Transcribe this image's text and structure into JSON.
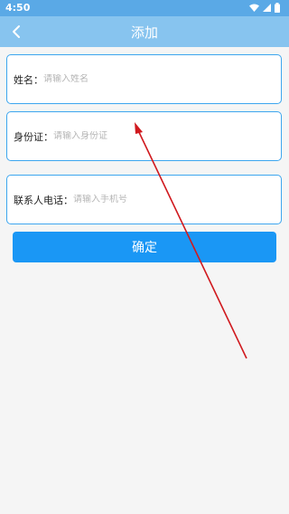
{
  "status_bar": {
    "time": "4:50",
    "icons": [
      "wifi-icon",
      "cell-signal-icon",
      "battery-icon"
    ]
  },
  "app_bar": {
    "title": "添加",
    "back_icon": "chevron-left-icon"
  },
  "form": {
    "name": {
      "label": "姓名：",
      "placeholder": "请输入姓名",
      "value": ""
    },
    "id_card": {
      "label": "身份证：",
      "placeholder": "请输入身份证",
      "value": ""
    },
    "phone": {
      "label": "联系人电话：",
      "placeholder": "请输入手机号",
      "value": ""
    },
    "confirm_label": "确定"
  },
  "colors": {
    "status_bar": "#5aa9e6",
    "app_bar": "#87c4ef",
    "field_border": "#3da6ef",
    "button": "#1a97f5",
    "annotation_arrow": "#d0191e"
  }
}
